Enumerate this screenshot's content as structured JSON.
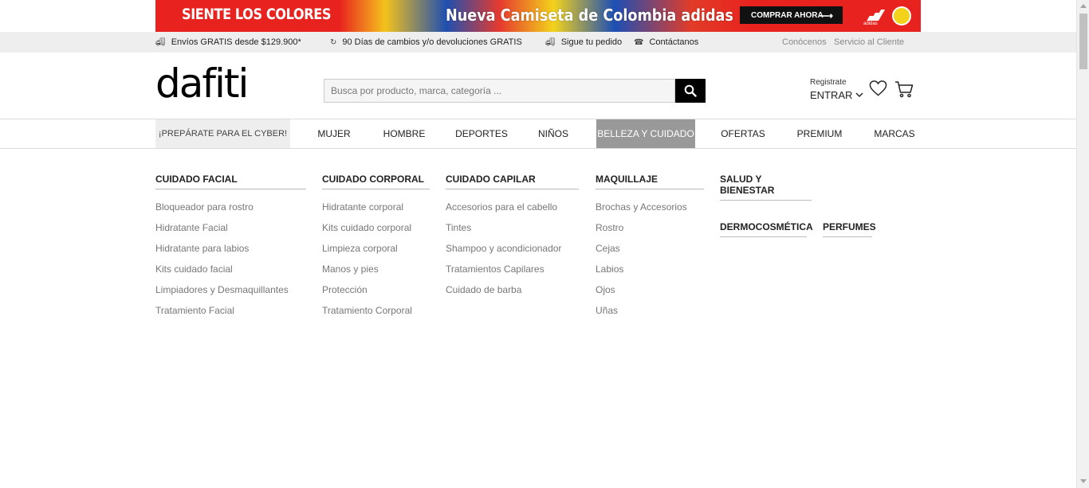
{
  "promo": {
    "left_text": "SIENTE LOS COLORES",
    "center_text": "Nueva Camiseta de Colombia adidas",
    "cta_label": "COMPRAR AHORA",
    "brand_label": "adidas"
  },
  "topbar": {
    "shipping": "Envíos GRATIS desde $129.900*",
    "returns": "90 Días de cambios y/o devoluciones GRATIS",
    "track": "Sigue tu pedido",
    "contact": "Contáctanos",
    "about": "Conócenos",
    "service": "Servicio al Cliente"
  },
  "header": {
    "logo": "dafiti",
    "search_placeholder": "Busca por producto, marca, categoría ...",
    "register": "Registrate",
    "enter": "ENTRAR"
  },
  "nav": {
    "items": [
      "¡PREPÁRATE PARA EL CYBER!",
      "MUJER",
      "HOMBRE",
      "DEPORTES",
      "NIÑOS",
      "BELLEZA Y CUIDADO",
      "OFERTAS",
      "PREMIUM",
      "MARCAS"
    ],
    "active": "BELLEZA Y CUIDADO"
  },
  "menu": {
    "facial": {
      "title": "CUIDADO FACIAL",
      "items": [
        "Bloqueador para rostro",
        "Hidratante Facial",
        "Hidratante para labios",
        "Kits cuidado facial",
        "Limpiadores y Desmaquillantes",
        "Tratamiento Facial"
      ]
    },
    "corporal": {
      "title": "CUIDADO CORPORAL",
      "items": [
        "Hidratante corporal",
        "Kits cuidado corporal",
        "Limpieza corporal",
        "Manos y pies",
        "Protección",
        "Tratamiento Corporal"
      ]
    },
    "capilar": {
      "title": "CUIDADO CAPILAR",
      "items": [
        "Accesorios para el cabello",
        "Tintes",
        "Shampoo y acondicionador",
        "Tratamientos Capilares",
        "Cuidado de barba"
      ]
    },
    "maquillaje": {
      "title": "MAQUILLAJE",
      "items": [
        "Brochas y Accesorios",
        "Rostro",
        "Cejas",
        "Labios",
        "Ojos",
        "Uñas"
      ]
    },
    "salud": {
      "title": "SALUD Y BIENESTAR"
    },
    "dermo": {
      "title": "DERMOCOSMÉTICA"
    },
    "perfumes": {
      "title": "PERFUMES"
    }
  }
}
